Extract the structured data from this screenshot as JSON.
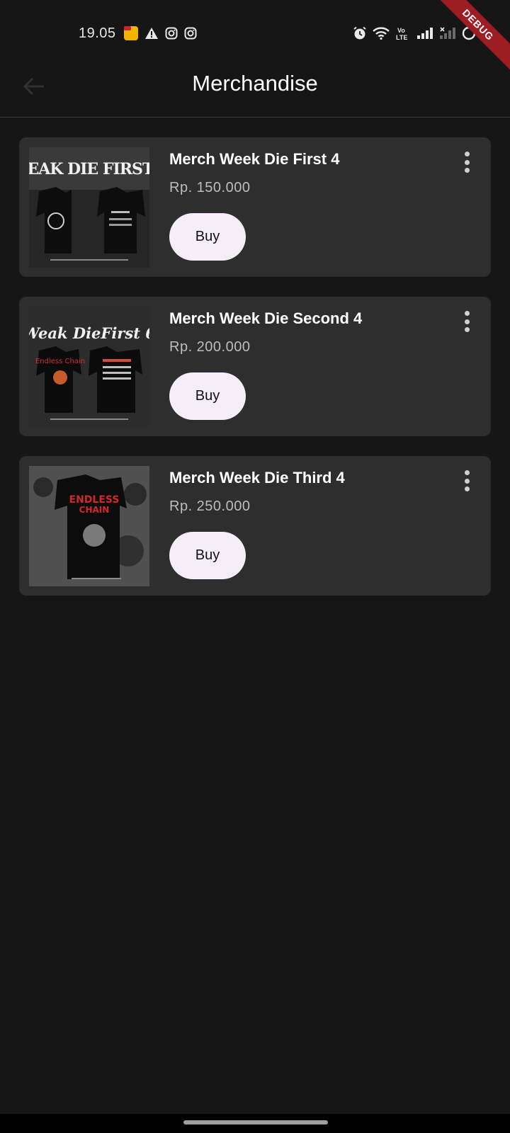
{
  "status_bar": {
    "time": "19.05",
    "left_icons": [
      "app-notification-icon",
      "warning-icon",
      "instagram-icon",
      "instagram-icon"
    ],
    "right_icons": [
      "alarm-icon",
      "wifi-icon",
      "volte-icon",
      "signal-icon",
      "signal-no-service-icon",
      "circle-icon"
    ]
  },
  "debug_banner": "DEBUG",
  "app_bar": {
    "title": "Merchandise",
    "back_icon": "arrow-left-icon"
  },
  "items": [
    {
      "name": "Merch Week Die First 4",
      "price": "Rp. 150.000",
      "buy_label": "Buy",
      "menu_icon": "more-vert-icon"
    },
    {
      "name": "Merch Week Die Second 4",
      "price": "Rp. 200.000",
      "buy_label": "Buy",
      "menu_icon": "more-vert-icon"
    },
    {
      "name": "Merch Week Die Third 4",
      "price": "Rp. 250.000",
      "buy_label": "Buy",
      "menu_icon": "more-vert-icon"
    }
  ],
  "colors": {
    "background": "#161616",
    "card": "#2e2e2e",
    "button": "#f5eef8",
    "price_text": "#bdbdbd",
    "debug_ribbon": "#9e1d22"
  }
}
